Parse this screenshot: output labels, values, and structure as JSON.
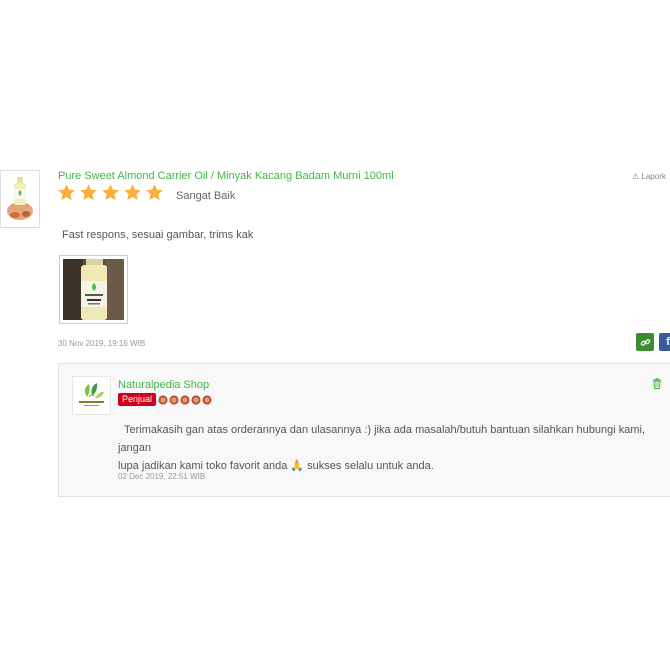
{
  "review": {
    "product_name": "Pure Sweet Almond Carrier Oil / Minyak Kacang Badam Murni 100ml",
    "report_label": "Lapork",
    "rating": 5,
    "rating_max": 5,
    "rating_label": "Sangat Baik",
    "text": "Fast respons, sesuai gambar, trims kak",
    "date": "30 Nov 2019, 19:16 WIB",
    "share_facebook_glyph": "f"
  },
  "reply": {
    "shop_name": "Naturalpedia Shop",
    "badge": "Penjual",
    "reputation_medals": 5,
    "text_line1": "Terimakasih gan atas orderannya dan ulasannya :) jika ada masalah/butuh bantuan silahkan hubungi kami, jangan",
    "text_line2": "lupa jadikan kami toko favorit anda 🙏 sukses selalu untuk anda.",
    "date": "02 Dec 2019, 22:51 WIB"
  },
  "colors": {
    "brand_green": "#42b549",
    "star_yellow": "#fbb03b",
    "badge_red": "#d0021b",
    "facebook_blue": "#3b5998"
  }
}
